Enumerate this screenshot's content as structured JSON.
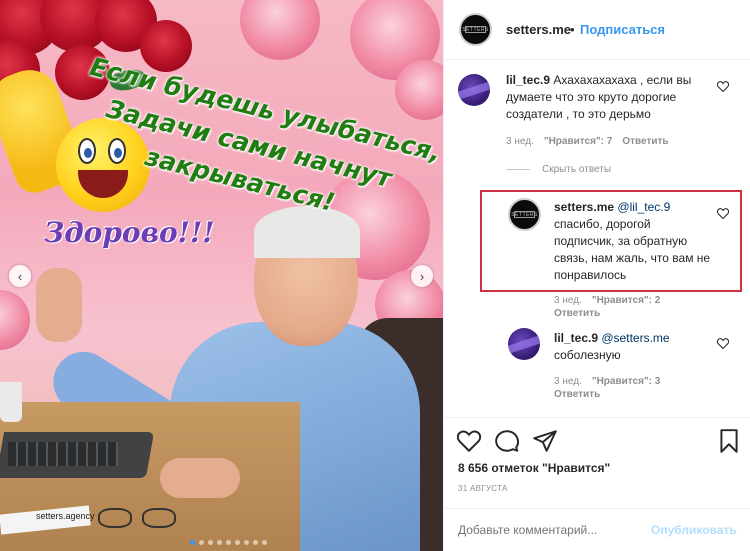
{
  "post_image": {
    "caption_lines": [
      "Если будешь улыбаться,",
      "Задачи сами начнут",
      "закрываться!"
    ],
    "greeting": "Здорово!!!",
    "watermark": "setters.agency",
    "prev_arrow": "‹",
    "next_arrow": "›",
    "carousel_dot_count": 9,
    "carousel_active_index": 0
  },
  "header": {
    "avatar_logo": "SETTERS",
    "username": "setters.me",
    "separator": "•",
    "follow_label": "Подписаться"
  },
  "comments": [
    {
      "username": "lil_tec.9",
      "text": "Ахахахахахаха , если вы думаете что это круто дорогие создатели , то это дерьмо",
      "time": "3 нед.",
      "likes_label": "\"Нравится\": 7",
      "reply_label": "Ответить"
    }
  ],
  "hide_replies_label": "Скрыть ответы",
  "replies": [
    {
      "username": "setters.me",
      "mention": "@lil_tec.9",
      "text": "спасибо, дорогой подписчик, за обратную связь, нам жаль, что вам не понравилось",
      "time": "3 нед.",
      "likes_label": "\"Нравится\": 2",
      "reply_label": "Ответить",
      "avatar_logo": "SETTERS"
    },
    {
      "username": "lil_tec.9",
      "mention": "@setters.me",
      "text": "соболезную",
      "time": "3 нед.",
      "likes_label": "\"Нравится\": 3",
      "reply_label": "Ответить"
    }
  ],
  "actions": {
    "likes_count": "8 656 отметок \"Нравится\"",
    "date": "31 АВГУСТА",
    "icons": [
      "heart-icon",
      "comment-icon",
      "share-icon",
      "bookmark-icon"
    ]
  },
  "add_comment": {
    "placeholder": "Добавьте комментарий...",
    "publish_label": "Опубликовать"
  },
  "colors": {
    "link_blue": "#3897f0",
    "mention": "#003569",
    "muted": "#8e8e8e",
    "highlight": "#d0303f",
    "publish_disabled": "#b2dffc"
  }
}
